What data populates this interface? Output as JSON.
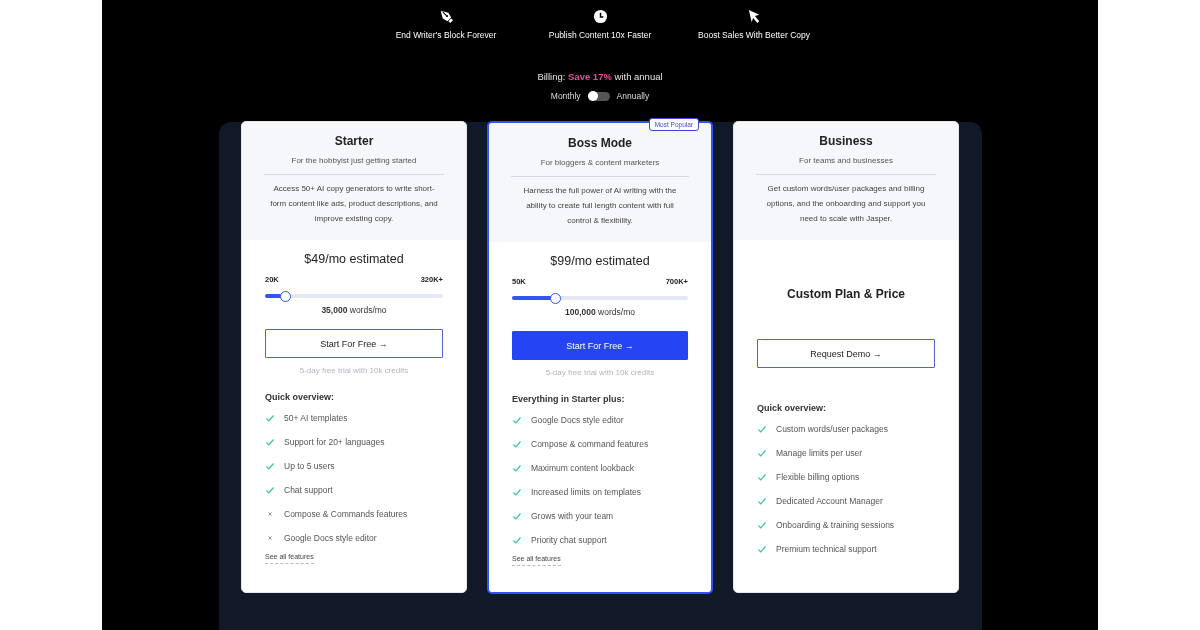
{
  "benefits": [
    {
      "label": "End Writer's Block Forever"
    },
    {
      "label": "Publish Content 10x Faster"
    },
    {
      "label": "Boost Sales With Better Copy"
    }
  ],
  "billing": {
    "text": "Billing: **Save 17%** with annual",
    "monthly_label": "Monthly",
    "annually_label": "Annually",
    "annual": false
  },
  "plans": [
    {
      "name": "Starter",
      "tagline": "For the hobbyist just getting started",
      "description": "Access 50+ AI copy generators to write short-form content like ads, product descriptions, and improve existing copy.",
      "featured": false,
      "kind": "slider",
      "price": "$49/mo estimated",
      "min_label": "20K",
      "max_label": "320K+",
      "level": 0.12,
      "words": "**35,000** words/mo",
      "button": "Start For Free →",
      "primary": false,
      "trial": "5-day free trial with 10k credits",
      "overview_title": "Quick overview:",
      "features": [
        {
          "label": "50+ AI templates",
          "included": true
        },
        {
          "label": "Support for 20+ languages",
          "included": true
        },
        {
          "label": "Up to 5 users",
          "included": true
        },
        {
          "label": "Chat support",
          "included": true
        },
        {
          "label": "Compose & Commands features",
          "included": false
        },
        {
          "label": "Google Docs style editor",
          "included": false
        }
      ],
      "see_all": "See all features"
    },
    {
      "name": "Boss Mode",
      "tagline": "For bloggers & content marketers",
      "description": "Harness the full power of AI writing with the ability to create full length content with full control & flexibility.",
      "featured": true,
      "badge": "Most Popular",
      "kind": "slider",
      "price": "$99/mo estimated",
      "min_label": "50K",
      "max_label": "700K+",
      "level": 0.25,
      "words": "**100,000** words/mo",
      "button": "Start For Free →",
      "primary": true,
      "trial": "5-day free trial with 10k credits",
      "overview_title": "Everything in Starter plus:",
      "features": [
        {
          "label": "Google Docs style editor",
          "included": true
        },
        {
          "label": "Compose & command features",
          "included": true
        },
        {
          "label": "Maximum content lookback",
          "included": true
        },
        {
          "label": "Increased limits on templates",
          "included": true
        },
        {
          "label": "Grows with your team",
          "included": true
        },
        {
          "label": "Priority chat support",
          "included": true
        }
      ],
      "see_all": "See all features"
    },
    {
      "name": "Business",
      "tagline": "For teams and businesses",
      "description": "Get custom words/user packages and billing options, and the onboarding and support you need to scale with Jasper.",
      "featured": false,
      "kind": "custom",
      "price": "Custom Plan & Price",
      "button": "Request Demo →",
      "primary": false,
      "overview_title": "Quick overview:",
      "features": [
        {
          "label": "Custom words/user packages",
          "included": true
        },
        {
          "label": "Manage limits per user",
          "included": true
        },
        {
          "label": "Flexible billing options",
          "included": true
        },
        {
          "label": "Dedicated Account Manager",
          "included": true
        },
        {
          "label": "Onboarding & training sessions",
          "included": true
        },
        {
          "label": "Premium technical support",
          "included": true
        }
      ]
    }
  ]
}
